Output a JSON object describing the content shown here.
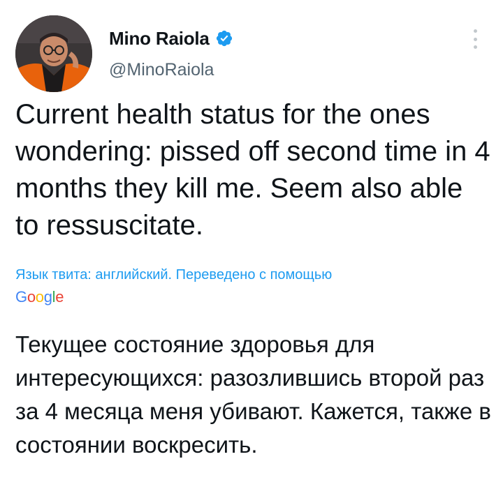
{
  "author": {
    "display_name": "Mino Raiola",
    "handle": "@MinoRaiola",
    "verified": true
  },
  "icons": {
    "verified": "verified-badge-icon",
    "more": "more-vertical-icon"
  },
  "tweet": {
    "text": "Current health status for the ones wondering: pissed off second time in 4 months they kill me. Seem also able to ressuscitate."
  },
  "translation": {
    "meta_label": "Язык твита: английский. Переведено с помощью",
    "provider": "Google",
    "text": "Текущее состояние здоровья для интересующихся: разозлившись второй раз за 4 месяца меня убивают. Кажется, также в состоянии воскресить."
  },
  "colors": {
    "link": "#1d9bf0",
    "text": "#0f1419",
    "secondary": "#536471",
    "verified": "#1d9bf0",
    "google_blue": "#4285f4",
    "google_red": "#ea4335",
    "google_yellow": "#fbbc05",
    "google_green": "#34a853"
  }
}
